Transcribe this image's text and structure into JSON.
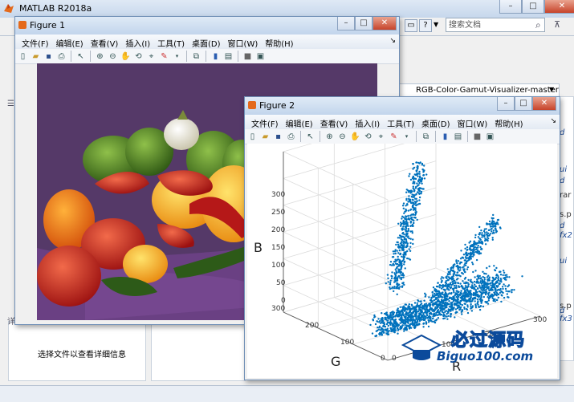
{
  "main_window": {
    "title": "MATLAB R2018a",
    "search_placeholder": "搜索文档",
    "path": "RGB-Color-Gamut-Visualizer-master",
    "help_icon": "?",
    "file_info_text": "选择文件以查看详细信息",
    "right_panel_snippets": [
      "d",
      "ui",
      "d",
      "ui",
      "rar",
      "s.p",
      "d",
      "fx2",
      "ui",
      "s.p",
      "d",
      "fx3"
    ]
  },
  "figure1": {
    "title": "Figure 1",
    "menus": [
      "文件(F)",
      "编辑(E)",
      "查看(V)",
      "插入(I)",
      "工具(T)",
      "桌面(D)",
      "窗口(W)",
      "帮助(H)"
    ],
    "image_desc": "peppers"
  },
  "figure2": {
    "title": "Figure 2",
    "menus": [
      "文件(F)",
      "编辑(E)",
      "查看(V)",
      "插入(I)",
      "工具(T)",
      "桌面(D)",
      "窗口(W)",
      "帮助(H)"
    ]
  },
  "chart_data": {
    "type": "scatter",
    "title": "",
    "xlabel": "R",
    "ylabel": "G",
    "zlabel": "B",
    "xlim": [
      0,
      300
    ],
    "ylim": [
      0,
      300
    ],
    "zlim": [
      0,
      300
    ],
    "x_ticks": [
      "0",
      "100",
      "200",
      "300"
    ],
    "y_ticks": [
      "0",
      "100",
      "200",
      "300"
    ],
    "z_ticks": [
      "0",
      "50",
      "100",
      "150",
      "200",
      "250",
      "300"
    ],
    "grid": true,
    "color": "#0072bd"
  },
  "watermark": {
    "text_main": "必过源码",
    "text_url": "Biguo100.com"
  }
}
